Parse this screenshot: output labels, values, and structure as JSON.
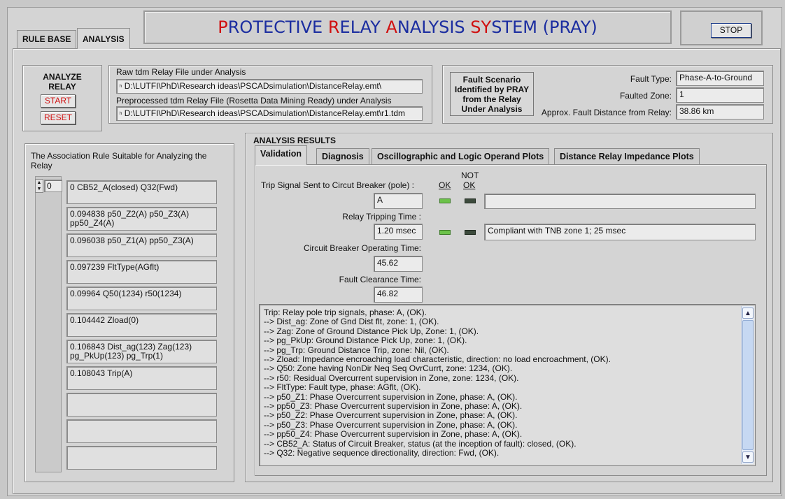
{
  "tabs": [
    "RULE BASE",
    "ANALYSIS"
  ],
  "app_title": {
    "segments": [
      {
        "text": "P",
        "red": true
      },
      {
        "text": "ROTECTIVE ",
        "red": false
      },
      {
        "text": "R",
        "red": true
      },
      {
        "text": "ELAY ",
        "red": false
      },
      {
        "text": "A",
        "red": true
      },
      {
        "text": "NALYSIS ",
        "red": false
      },
      {
        "text": "SY",
        "red": true
      },
      {
        "text": "STEM  (PRAY)",
        "red": false
      }
    ]
  },
  "stop_label": "STOP",
  "analyze": {
    "heading_1": "ANALYZE",
    "heading_2": "RELAY",
    "start_label": "START",
    "reset_label": "RESET"
  },
  "files": {
    "raw_label": "Raw tdm Relay File under Analysis",
    "raw_path": "D:\\LUTFI\\PhD\\Research ideas\\PSCADsimulation\\DistanceRelay.emt\\",
    "pre_label": "Preprocessed tdm Relay File  (Rosetta Data Mining Ready) under Analysis",
    "pre_path": "D:\\LUTFI\\PhD\\Research ideas\\PSCADsimulation\\DistanceRelay.emt\\r1.tdm",
    "path_icon": "file-path-icon"
  },
  "fault": {
    "heading_1": "Fault Scenario",
    "heading_2": "Identified by PRAY",
    "heading_3": "from the Relay",
    "heading_4": "Under Analysis",
    "type_label": "Fault Type:",
    "type_value": "Phase-A-to-Ground",
    "zone_label": "Faulted Zone:",
    "zone_value": "1",
    "distance_label": "Approx. Fault Distance from Relay:",
    "distance_value": "38.86 km"
  },
  "rules_panel": {
    "heading": "The Association Rule Suitable for Analyzing the Relay",
    "index_value": "0",
    "items": [
      [
        "0 CB52_A(closed) Q32(Fwd)"
      ],
      [
        "0.094838 p50_Z2(A) p50_Z3(A)",
        "pp50_Z4(A)"
      ],
      [
        "0.096038 p50_Z1(A) pp50_Z3(A)"
      ],
      [
        "0.097239 FltType(AGflt)"
      ],
      [
        "0.09964 Q50(1234) r50(1234)"
      ],
      [
        "0.104442 Zload(0)"
      ],
      [
        "0.106843 Dist_ag(123) Zag(123)",
        "pg_PkUp(123) pg_Trp(1)"
      ],
      [
        "0.108043 Trip(A)"
      ],
      [
        ""
      ],
      [
        ""
      ],
      [
        ""
      ]
    ]
  },
  "results": {
    "heading": "ANALYSIS RESULTS",
    "tabs": [
      "Validation",
      "Diagnosis",
      "Oscillographic and Logic Operand Plots",
      "Distance Relay Impedance Plots"
    ],
    "ok_label": "OK",
    "not_label": "NOT",
    "not_ok_label": "OK",
    "trip_label": "Trip Signal Sent to Circut Breaker (pole) :",
    "trip_value": "A",
    "trip_comment": "",
    "tripping_time_label": "Relay Tripping Time :",
    "tripping_time_value": "1.20 msec",
    "tripping_time_comment": "Compliant with TNB zone 1; 25 msec",
    "cb_time_label": "Circuit Breaker Operating Time:",
    "cb_time_value": "45.62",
    "clearance_label": "Fault Clearance Time:",
    "clearance_value": "46.82",
    "log": [
      "Trip: Relay pole trip signals, phase: A, (OK).",
      "--> Dist_ag: Zone of Gnd Dist flt, zone: 1, (OK).",
      "--> Zag: Zone of Ground Distance Pick Up, Zone: 1, (OK).",
      "--> pg_PkUp: Ground Distance Pick Up, zone: 1, (OK).",
      "--> pg_Trp: Ground Distance Trip, zone: Nil, (OK).",
      "--> Zload: Impedance encroaching load characteristic, direction: no load encroachment, (OK).",
      "--> Q50: Zone having NonDir Neq Seq OvrCurrt, zone: 1234, (OK).",
      "--> r50: Residual Overcurrent supervision in Zone, zone: 1234, (OK).",
      "--> FltType: Fault type, phase: AGflt, (OK).",
      "--> p50_Z1: Phase Overcurrent supervision in Zone, phase: A, (OK).",
      "--> pp50_Z3: Phase Overcurrent supervision in Zone, phase: A, (OK).",
      "--> p50_Z2: Phase Overcurrent supervision in Zone, phase: A, (OK).",
      "--> p50_Z3: Phase Overcurrent supervision in Zone, phase: A, (OK).",
      "--> pp50_Z4: Phase Overcurrent supervision in Zone, phase: A, (OK).",
      "--> CB52_A: Status of Circuit Breaker, status (at the inception of fault): closed, (OK).",
      "--> Q32: Negative sequence directionality, direction: Fwd, (OK)."
    ]
  },
  "colors": {
    "title_blue": "#1b2da0",
    "title_red": "#d01010",
    "led_on": "#6cc24a",
    "led_off": "#3c4a3c"
  }
}
